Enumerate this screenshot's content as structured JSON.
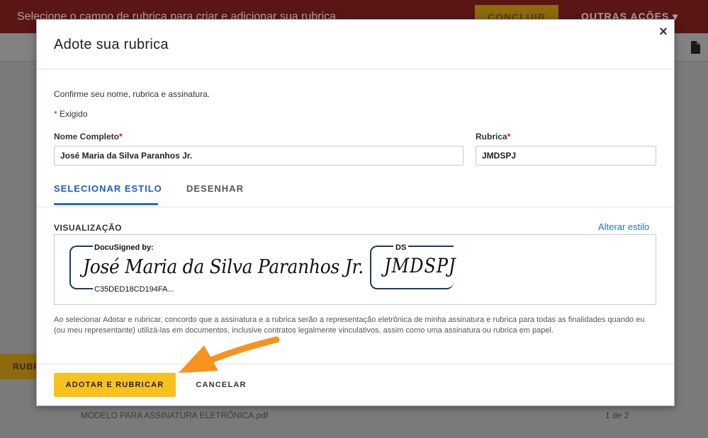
{
  "background": {
    "topbar_message": "Selecione o campo de rubrica para criar e adicionar sua rubrica",
    "concluir_label": "CONCLUIR",
    "outras_acoes_label": "OUTRAS AÇÕES ▾",
    "side_button_label": "RUBR",
    "document_name": "MODELO PARA ASSINATURA ELETRÔNICA.pdf",
    "page_indicator": "1 de 2"
  },
  "modal": {
    "title": "Adote sua rubrica",
    "close_symbol": "×",
    "confirm_text": "Confirme seu nome, rubrica e assinatura.",
    "required_star": "*",
    "required_label": " Exigido",
    "full_name_label": "Nome Completo",
    "full_name_value": "José Maria da Silva Paranhos Jr.",
    "initials_label": "Rubrica",
    "initials_value": "JMDSPJ",
    "tabs": [
      {
        "label": "SELECIONAR ESTILO",
        "active": true
      },
      {
        "label": "DESENHAR",
        "active": false
      }
    ],
    "preview_label": "VISUALIZAÇÃO",
    "change_style_link": "Alterar estilo",
    "signature": {
      "header": "DocuSigned by:",
      "script_text": "José Maria da Silva Paranhos Jr.",
      "hash": "C35DED18CD194FA..."
    },
    "initials_stamp": {
      "header": "DS",
      "script_text": "JMDSPJ"
    },
    "disclaimer": "Ao selecionar Adotar e rubricar, concordo que a assinatura e a rubrica serão a representação eletrônica de minha assinatura e rubrica para todas as finalidades quando eu (ou meu representante) utilizá-las em documentos, inclusive contratos legalmente vinculativos, assim como uma assinatura ou rubrica em papel.",
    "adopt_button": "ADOTAR E RUBRICAR",
    "cancel_button": "CANCELAR"
  },
  "colors": {
    "accent_yellow": "#f8c21c",
    "link_blue": "#1f6fd0",
    "required_red": "#c8102e",
    "annotation_arrow": "#f7931e"
  },
  "icons": [
    "file-icon",
    "close-icon",
    "arrow-annotation-icon"
  ]
}
